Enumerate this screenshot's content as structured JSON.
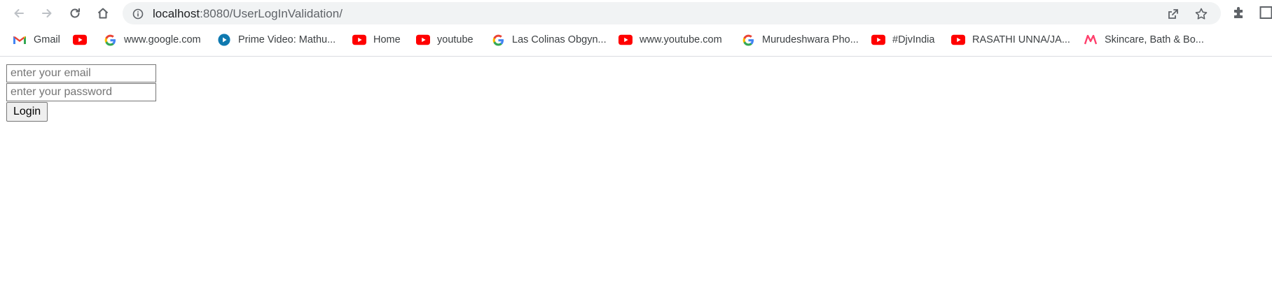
{
  "browser": {
    "url_host": "localhost",
    "url_path": ":8080/UserLogInValidation/",
    "bookmarks": [
      {
        "label": "Gmail",
        "icon": "gmail-icon"
      },
      {
        "label": "",
        "icon": "youtube-icon"
      },
      {
        "label": "www.google.com",
        "icon": "google-icon"
      },
      {
        "label": "Prime Video: Mathu...",
        "icon": "prime-video-icon"
      },
      {
        "label": "Home",
        "icon": "youtube-icon"
      },
      {
        "label": "youtube",
        "icon": "youtube-icon"
      },
      {
        "label": "Las Colinas Obgyn...",
        "icon": "google-icon"
      },
      {
        "label": "www.youtube.com",
        "icon": "youtube-icon"
      },
      {
        "label": "Murudeshwara Pho...",
        "icon": "google-icon"
      },
      {
        "label": "#DjvIndia",
        "icon": "youtube-icon"
      },
      {
        "label": "RASATHI UNNA/JA...",
        "icon": "youtube-icon"
      },
      {
        "label": "Skincare, Bath & Bo...",
        "icon": "myntra-icon"
      }
    ]
  },
  "login_form": {
    "email_placeholder": "enter your email",
    "password_placeholder": "enter your password",
    "login_label": "Login"
  },
  "colors": {
    "youtube_red": "#ff0000",
    "omnibox_bg": "#f1f3f4",
    "icon_gray": "#5f6368"
  }
}
